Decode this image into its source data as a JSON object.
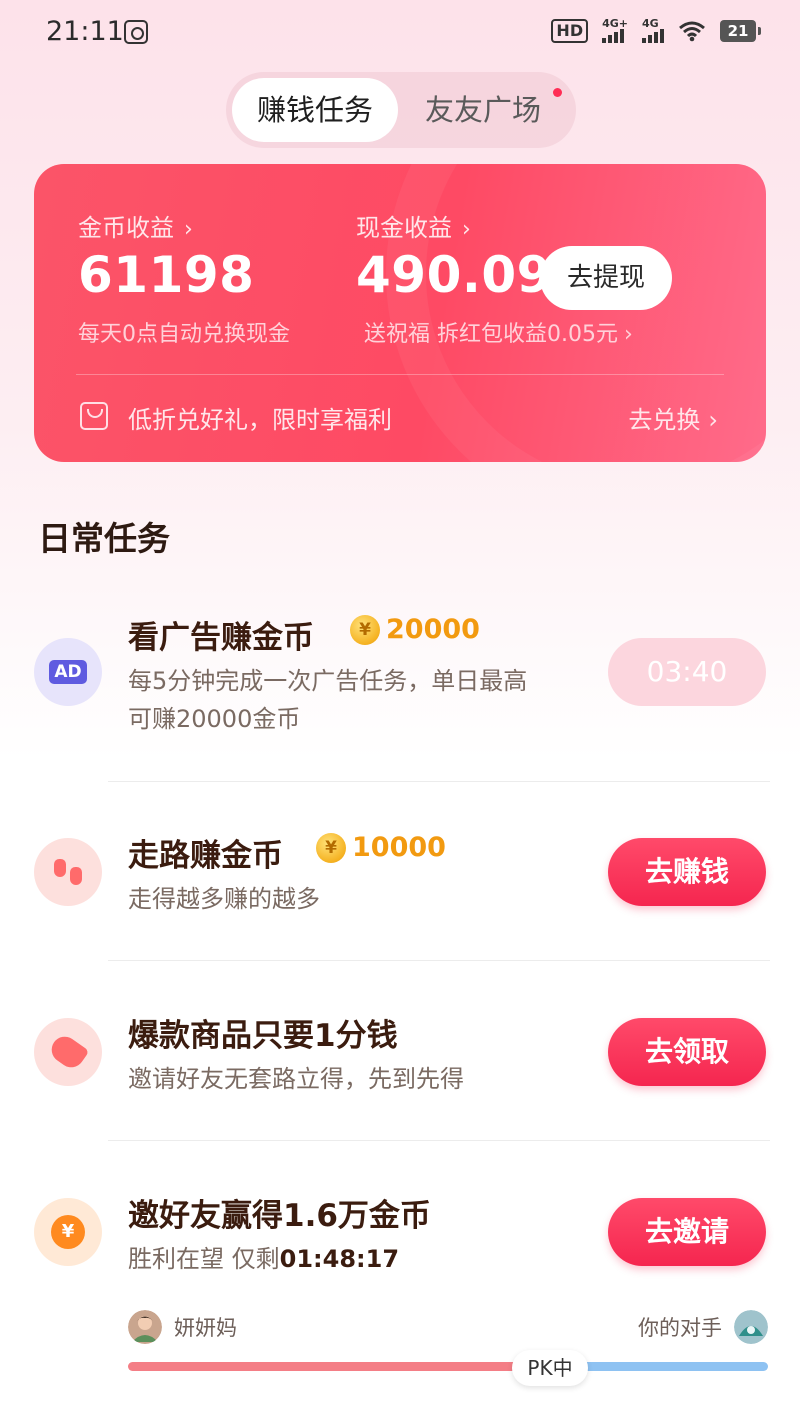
{
  "status_bar": {
    "time": "21:11",
    "network_hd": "HD",
    "network_1": "4G+",
    "network_2": "4G",
    "battery": "21"
  },
  "tabs": [
    {
      "label": "赚钱任务",
      "active": true
    },
    {
      "label": "友友广场",
      "active": false,
      "has_dot": true
    }
  ],
  "earnings": {
    "coin_label": "金币收益",
    "coin_value": "61198",
    "coin_sub": "每天0点自动兑换现金",
    "cash_label": "现金收益",
    "cash_value": "490.09",
    "cash_sub": "送祝福 拆红包收益0.05元",
    "withdraw_button": "去提现",
    "promo_text": "低折兑好礼，限时享福利",
    "redeem_link": "去兑换"
  },
  "section_title": "日常任务",
  "tasks": [
    {
      "title": "看广告赚金币",
      "reward": "20000",
      "desc_line1": "每5分钟完成一次广告任务，单日最高",
      "desc_line2": "可赚20000金币",
      "button": "03:40",
      "icon_text": "AD"
    },
    {
      "title": "走路赚金币",
      "reward": "10000",
      "desc_line1": "走得越多赚的越多",
      "button": "去赚钱"
    },
    {
      "title": "爆款商品只要1分钱",
      "desc_line1": "邀请好友无套路立得，先到先得",
      "button": "去领取"
    },
    {
      "title": "邀好友赢得1.6万金币",
      "desc_prefix": "胜利在望 仅剩",
      "countdown": "01:48:17",
      "button": "去邀请",
      "icon_text": "¥"
    }
  ],
  "pk": {
    "user_name": "妍妍妈",
    "opponent_label": "你的对手",
    "status": "PK中"
  },
  "coin_symbol": "¥",
  "colors": {
    "accent": "#fe4a64",
    "reward": "#f29a10",
    "pk_left": "#f47e86",
    "pk_right": "#8ec2f2"
  }
}
